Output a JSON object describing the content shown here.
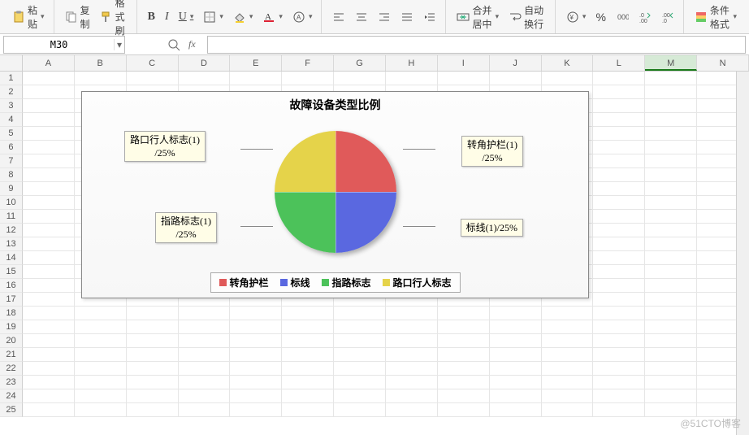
{
  "toolbar": {
    "paste": "粘贴",
    "copy": "复制",
    "format_painter": "格式刷",
    "bold": "B",
    "italic": "I",
    "underline": "U",
    "merge_center": "合并居中",
    "wrap": "自动换行",
    "cond_format": "条件格式"
  },
  "namebox": {
    "value": "M30"
  },
  "fx_label": "fx",
  "grid": {
    "cols": [
      "A",
      "B",
      "C",
      "D",
      "E",
      "F",
      "G",
      "H",
      "I",
      "J",
      "K",
      "L",
      "M",
      "N"
    ],
    "rows": 25,
    "active_col": "M"
  },
  "chart_data": {
    "type": "pie",
    "title": "故障设备类型比例",
    "series": [
      {
        "name": "转角护栏",
        "value": 1,
        "pct": 25,
        "color": "#e05a5a"
      },
      {
        "name": "标线",
        "value": 1,
        "pct": 25,
        "color": "#5a68e0"
      },
      {
        "name": "指路标志",
        "value": 1,
        "pct": 25,
        "color": "#4cc25a"
      },
      {
        "name": "路口行人标志",
        "value": 1,
        "pct": 25,
        "color": "#e5d34a"
      }
    ],
    "callouts": {
      "ne": "转角护栏(1)\n/25%",
      "se": "标线(1)/25%",
      "sw": "指路标志(1)\n/25%",
      "nw": "路口行人标志(1)\n/25%"
    },
    "legend": [
      "转角护栏",
      "标线",
      "指路标志",
      "路口行人标志"
    ]
  },
  "watermark": "@51CTO博客"
}
